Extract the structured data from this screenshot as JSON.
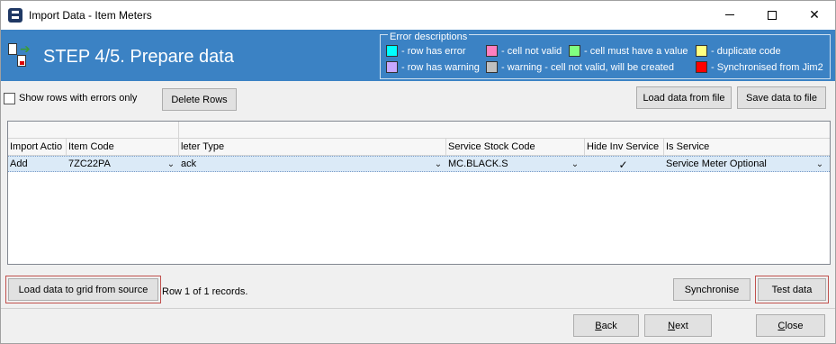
{
  "window": {
    "title": "Import Data - Item Meters"
  },
  "header": {
    "step_title": "STEP 4/5. Prepare data",
    "error_legend_title": "Error descriptions",
    "errors": [
      {
        "color": "#00ffff",
        "label": "- row has error"
      },
      {
        "color": "#ff7fbf",
        "label": "- cell not valid"
      },
      {
        "color": "#80ff80",
        "label": "- cell must have a value"
      },
      {
        "color": "#ffff80",
        "label": "- duplicate code"
      },
      {
        "color": "#c8a8ff",
        "label": "- row has warning"
      },
      {
        "color": "#c0c0c0",
        "label": "- warning - cell not valid, will be created"
      },
      {
        "color": "#ff0000",
        "label": "- Synchronised from Jim2"
      }
    ]
  },
  "toolbar": {
    "show_errors_label": "Show rows with errors only",
    "show_errors_checked": false,
    "delete_rows_label": "Delete Rows",
    "load_file_label": "Load data from file",
    "save_file_label": "Save data to file"
  },
  "grid": {
    "columns": [
      "Import Actio",
      "Item Code",
      "leter Type",
      "Service Stock Code",
      "Hide Inv Service",
      "Is Service"
    ],
    "rows": [
      {
        "import_action": "Add",
        "item_code": "7ZC22PA",
        "meter_type": "ack",
        "service_stock_code": "MC.BLACK.S",
        "hide_inv_service": true,
        "is_service": "Service Meter Optional"
      }
    ]
  },
  "footer": {
    "load_grid_label": "Load data to grid from source",
    "record_status": "Row 1 of 1 records.",
    "synchronise_label": "Synchronise",
    "test_data_label": "Test data",
    "back_label": "Back",
    "next_label": "Next",
    "close_label": "Close"
  }
}
